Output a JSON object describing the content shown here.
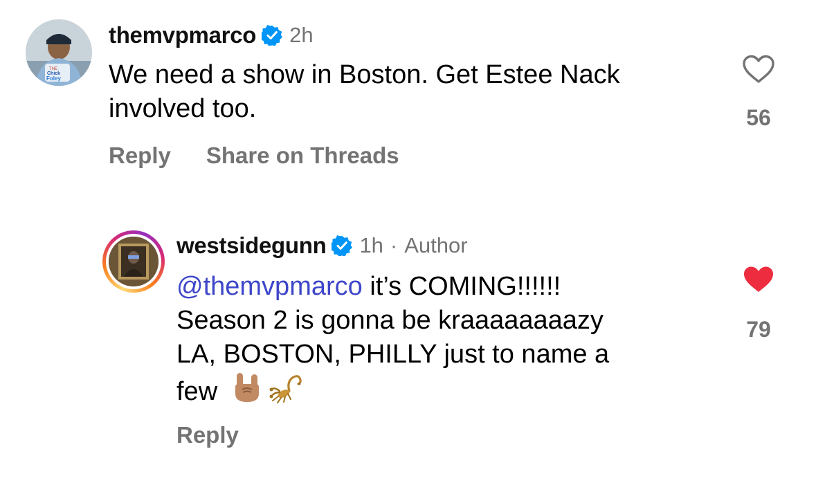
{
  "comments": [
    {
      "username": "themvpmarco",
      "verified": true,
      "time": "2h",
      "text_lines": [
        "We need a show in Boston. Get Estee Nack",
        "involved too."
      ],
      "actions": {
        "reply": "Reply",
        "share": "Share on Threads"
      },
      "like_count": "56",
      "liked": false,
      "avatar_text": [
        "THE",
        "Chick",
        "Foley"
      ]
    },
    {
      "username": "westsidegunn",
      "verified": true,
      "time": "1h",
      "separator": "·",
      "author_badge": "Author",
      "mention": "@themvpmarco",
      "text_line1_rest": " it’s COMING!!!!!!",
      "text_lines": [
        "Season 2 is gonna be kraaaaaaaazy",
        "LA, BOSTON, PHILLY just to name a",
        "few"
      ],
      "emojis": [
        "sign-of-horns-emoji",
        "scorpion-emoji"
      ],
      "actions": {
        "reply": "Reply"
      },
      "like_count": "79",
      "liked": true
    }
  ],
  "colors": {
    "secondary_text": "#737373",
    "verified_badge": "#0095f6",
    "liked_heart": "#ed2d3f",
    "mention": "#3e46c9"
  },
  "icons": [
    "verified-badge-icon",
    "heart-outline-icon",
    "heart-filled-icon"
  ]
}
